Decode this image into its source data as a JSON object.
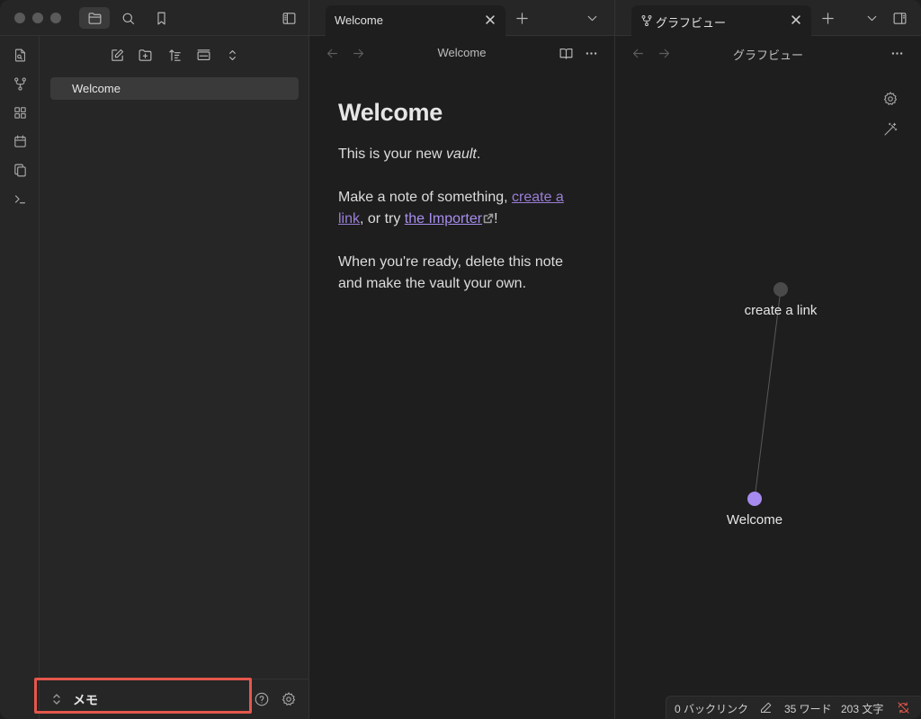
{
  "sidebar": {
    "files": [
      {
        "label": "Welcome"
      }
    ],
    "vault_name": "メモ"
  },
  "pane1": {
    "tab_label": "Welcome",
    "view_title": "Welcome",
    "note": {
      "heading": "Welcome",
      "p1_prefix": "This is your new ",
      "p1_em": "vault",
      "p1_suffix": ".",
      "p2_prefix": "Make a note of something, ",
      "p2_link": "create a link",
      "p2_middle": ", or try ",
      "p2_external": "the Importer",
      "p2_suffix": "!",
      "p3": "When you're ready, delete this note and make the vault your own."
    }
  },
  "pane2": {
    "tab_label": "グラフビュー",
    "view_title": "グラフビュー",
    "graph": {
      "nodes": [
        {
          "label": "create a link",
          "color": "#4a4a4a"
        },
        {
          "label": "Welcome",
          "color": "#a68af0"
        }
      ]
    }
  },
  "statusbar": {
    "backlinks": "0 バックリンク",
    "words": "35 ワード",
    "chars": "203 文字"
  },
  "colors": {
    "accent": "#a68af0",
    "highlight_box": "#e5574c",
    "sync_error": "#e5574c"
  }
}
